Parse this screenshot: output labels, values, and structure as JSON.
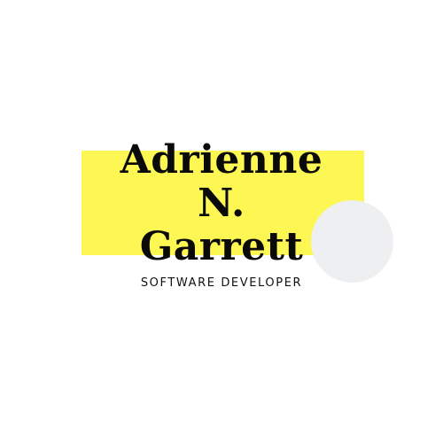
{
  "logo": {
    "name_lines": [
      "Adrienne",
      "N.",
      "Garrett"
    ],
    "subtitle": "SOFTWARE DEVELOPER"
  },
  "colors": {
    "background": "#ffffff",
    "accent_yellow": "#fdf754",
    "circle_grey": "#eeeff1",
    "text": "#0a0a0a"
  }
}
